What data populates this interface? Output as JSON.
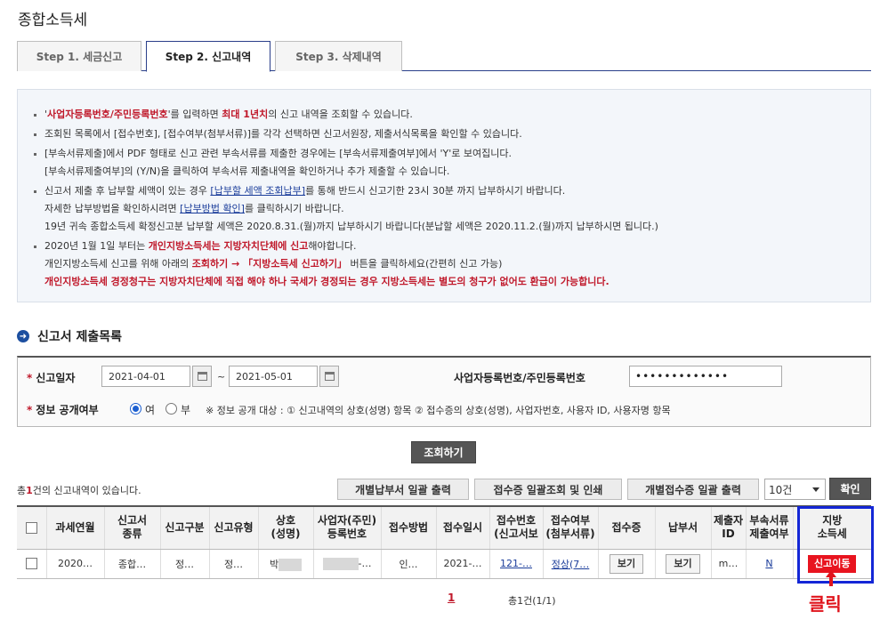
{
  "page": {
    "title": "종합소득세"
  },
  "tabs": [
    {
      "label": "Step 1. 세금신고",
      "active": false
    },
    {
      "label": "Step 2. 신고내역",
      "active": true
    },
    {
      "label": "Step 3. 삭제내역",
      "active": false
    }
  ],
  "notice": {
    "l1a": "'",
    "l1b": "사업자등록번호/주민등록번호",
    "l1c": "'를 입력하면 ",
    "l1d": "최대 1년치",
    "l1e": "의 신고 내역을 조회할 수 있습니다.",
    "l2": "조회된 목록에서 [접수번호], [접수여부(첨부서류)]를 각각 선택하면 신고서원장, 제출서식목록을 확인할 수 있습니다.",
    "l3a": "[부속서류제출]에서 PDF 형태로 신고 관련 부속서류를 제출한 경우에는 [부속서류제출여부]에서 'Y'로 보여집니다.",
    "l3b": "[부속서류제출여부]의 (Y/N)을 클릭하여 부속서류 제출내역을 확인하거나 추가 제출할 수 있습니다.",
    "l4a": "신고서 제출 후 납부할 세액이 있는 경우 ",
    "l4b": "[납부할 세액 조회납부]",
    "l4c": "를 통해 반드시 신고기한 23시 30분 까지 납부하시기 바랍니다.",
    "l4d": "자세한 납부방법을 확인하시려면 ",
    "l4e": "[납부방법 확인]",
    "l4f": "를 클릭하시기 바랍니다.",
    "l4g": "19년 귀속 종합소득세 확정신고분 납부할 세액은 2020.8.31.(월)까지 납부하시기 바랍니다(분납할 세액은 2020.11.2.(월)까지 납부하시면 됩니다.)",
    "l5a": "2020년 1월 1일 부터는 ",
    "l5b": "개인지방소득세는 지방자치단체에 신고",
    "l5c": "해야합니다.",
    "l5d": "개인지방소득세 신고를 위해 아래의 ",
    "l5e": "조회하기 → 「지방소득세 신고하기」",
    "l5f": " 버튼을 클릭하세요(간편히 신고 가능)",
    "l5g": "개인지방소득세 경정청구는 지방자치단체에 직접 해야 하나 국세가 경정되는 경우 지방소득세는 별도의 청구가 없어도 환급이 가능합니다."
  },
  "section": {
    "title": "신고서 제출목록",
    "icon": "arrow-right-circle-icon"
  },
  "search": {
    "date_label": "신고일자",
    "date_from": "2021-04-01",
    "tilde": "~",
    "date_to": "2021-05-01",
    "id_label": "사업자등록번호/주민등록번호",
    "id_value": "•••••••••••••",
    "public_label": "정보 공개여부",
    "opt_yes": "여",
    "opt_no": "부",
    "public_selected": "여",
    "public_note": "※ 정보 공개 대상 : ① 신고내역의 상호(성명) 항목 ② 접수증의 상호(성명), 사업자번호, 사용자 ID, 사용자명 항목",
    "search_button": "조회하기"
  },
  "list": {
    "count_prefix": "총",
    "count": "1",
    "count_suffix": "건의 신고내역이 있습니다.",
    "btn_bulk_payment": "개별납부서 일괄 출력",
    "btn_bulk_receipt": "접수증 일괄조회 및 인쇄",
    "btn_individual_receipt": "개별접수증 일괄 출력",
    "page_size": "10건",
    "confirm": "확인"
  },
  "table": {
    "headers": [
      {
        "l1": "",
        "l2": ""
      },
      {
        "l1": "과세연월",
        "l2": ""
      },
      {
        "l1": "신고서",
        "l2": "종류"
      },
      {
        "l1": "신고구분",
        "l2": ""
      },
      {
        "l1": "신고유형",
        "l2": ""
      },
      {
        "l1": "상호",
        "l2": "(성명)"
      },
      {
        "l1": "사업자(주민)",
        "l2": "등록번호"
      },
      {
        "l1": "접수방법",
        "l2": ""
      },
      {
        "l1": "접수일시",
        "l2": ""
      },
      {
        "l1": "접수번호",
        "l2": "(신고서보"
      },
      {
        "l1": "접수여부",
        "l2": "(첨부서류)"
      },
      {
        "l1": "접수증",
        "l2": ""
      },
      {
        "l1": "납부서",
        "l2": ""
      },
      {
        "l1": "제출자",
        "l2": "ID"
      },
      {
        "l1": "부속서류",
        "l2": "제출여부"
      },
      {
        "l1": "지방",
        "l2": "소득세"
      }
    ],
    "row": {
      "period": "2020…",
      "type": "종합…",
      "category": "정…",
      "kind": "정…",
      "name": "박",
      "reg_no": "-…",
      "method": "인…",
      "date": "2021-…",
      "receipt_no": "121-…",
      "status": "정상(7…",
      "receipt_btn": "보기",
      "payment_btn": "보기",
      "submitter": "m…",
      "attach": "N",
      "local_tax_btn": "신고이동"
    }
  },
  "highlight": {
    "text": "클릭",
    "color": "#e0141c",
    "box_color": "#1427d6"
  },
  "pagination": {
    "current": "1",
    "summary": "총1건(1/1)"
  }
}
